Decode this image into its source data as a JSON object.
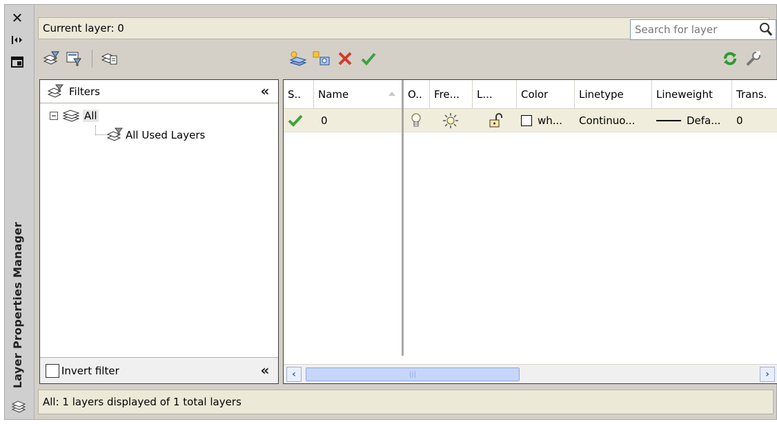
{
  "palette": {
    "title": "Layer Properties Manager"
  },
  "current_layer": "Current layer: 0",
  "search": {
    "placeholder": "Search for layer"
  },
  "filters": {
    "header": "Filters",
    "tree": [
      {
        "label": "All",
        "expanded": true
      },
      {
        "label": "All Used Layers"
      }
    ],
    "invert_label": "Invert filter",
    "invert_checked": false
  },
  "grid": {
    "columns": [
      "S..",
      "Name",
      "O..",
      "Fre...",
      "L...",
      "Color",
      "Linetype",
      "Lineweight",
      "Trans."
    ],
    "rows": [
      {
        "status": "current",
        "name": "0",
        "on": "lightbulb-icon",
        "freeze": "sun-icon",
        "lock": "unlock-icon",
        "color": "wh...",
        "linetype": "Continuo...",
        "lineweight": "Defa...",
        "transparency": "0"
      }
    ]
  },
  "status_text": "All: 1 layers displayed of 1 total layers",
  "colors": {
    "panel_bg": "#d4d0c8",
    "row_selected": "#f0eddc",
    "check_green": "#3ea33e",
    "delete_red": "#d43a2a",
    "scroll_thumb": "#c6d6fb"
  }
}
